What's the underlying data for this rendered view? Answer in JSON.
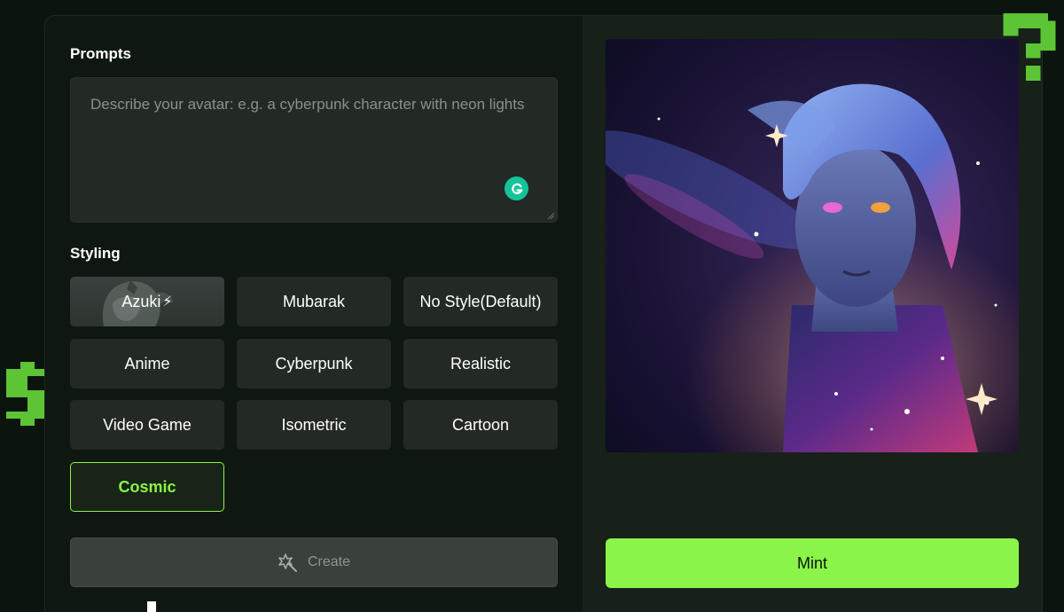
{
  "prompts": {
    "title": "Prompts",
    "placeholder": "Describe your avatar: e.g. a cyberpunk character with neon lights"
  },
  "styling": {
    "title": "Styling",
    "options": [
      {
        "label": "Azuki",
        "badge": "⚡"
      },
      {
        "label": "Mubarak"
      },
      {
        "label": "No Style(Default)"
      },
      {
        "label": "Anime"
      },
      {
        "label": "Cyberpunk"
      },
      {
        "label": "Realistic"
      },
      {
        "label": "Video Game"
      },
      {
        "label": "Isometric"
      },
      {
        "label": "Cartoon"
      },
      {
        "label": "Cosmic",
        "selected": true
      }
    ]
  },
  "actions": {
    "create_label": "Create",
    "mint_label": "Mint"
  },
  "colors": {
    "accent": "#8af449",
    "page_bg": "#0b140d",
    "button_bg": "#232a25"
  },
  "icons": {
    "dollar": "pixel-dollar-icon",
    "question": "pixel-question-icon",
    "create": "magic-wand-icon",
    "grammarly": "grammarly-icon"
  }
}
